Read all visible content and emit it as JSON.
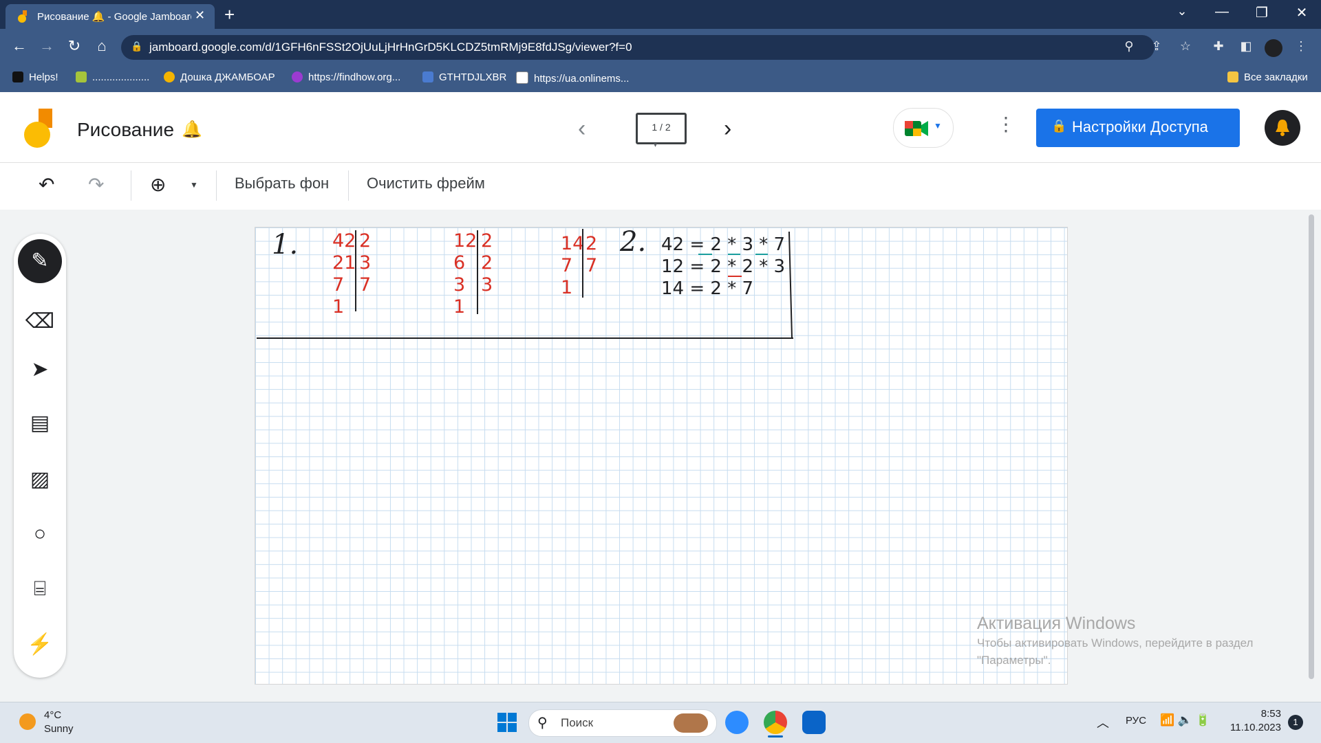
{
  "browser": {
    "tab_title": "Рисование 🔔 - Google Jamboard",
    "tab_close": "✕",
    "new_tab": "+",
    "window_min": "—",
    "window_max": "❐",
    "window_close": "✕",
    "url": "jamboard.google.com/d/1GFH6nFSSt2OjUuLjHrHnGrD5KLCDZ5tmRMj9E8fdJSg/viewer?f=0",
    "bookmarks": [
      {
        "label": "Helps!",
        "color": "#111111"
      },
      {
        "label": "....................",
        "color": "#a6c43b"
      },
      {
        "label": "Дошка ДЖАМБОАР",
        "color": "#f4b400"
      },
      {
        "label": "https://findhow.org...",
        "color": "#9b3bd1"
      },
      {
        "label": "GTHTDJLXBR",
        "color": "#4a7bd0"
      },
      {
        "label": "https://ua.onlinems...",
        "color": "#ffffff"
      }
    ],
    "all_bookmarks": "Все закладки"
  },
  "app": {
    "title": "Рисование",
    "title_emoji": "🔔",
    "frame_indicator": "1 / 2",
    "share_label": "Настройки Доступа",
    "lock_icon": "🔒"
  },
  "toolbar": {
    "choose_bg": "Выбрать фон",
    "clear_frame": "Очистить фрейм"
  },
  "canvas": {
    "label1": "1.",
    "label2": "2.",
    "div42": {
      "left": [
        "42",
        "21",
        "7",
        "1"
      ],
      "right": [
        "2",
        "3",
        "7"
      ]
    },
    "div12": {
      "left": [
        "12",
        "6",
        "3",
        "1"
      ],
      "right": [
        "2",
        "2",
        "3"
      ]
    },
    "div14": {
      "left": [
        "14",
        "7",
        "1"
      ],
      "right": [
        "2",
        "7"
      ]
    },
    "eq1": "42 = 2 * 3 * 7",
    "eq2": "12 = 2 * 2 * 3",
    "eq3": "14 = 2 * 7"
  },
  "watermark": {
    "line1": "Активация Windows",
    "line2": "Чтобы активировать Windows, перейдите в раздел",
    "line3": "\"Параметры\"."
  },
  "taskbar": {
    "temperature": "4°C",
    "condition": "Sunny",
    "search_placeholder": "Поиск",
    "language": "РУС",
    "time": "8:53",
    "date": "11.10.2023",
    "notifications": "1"
  }
}
